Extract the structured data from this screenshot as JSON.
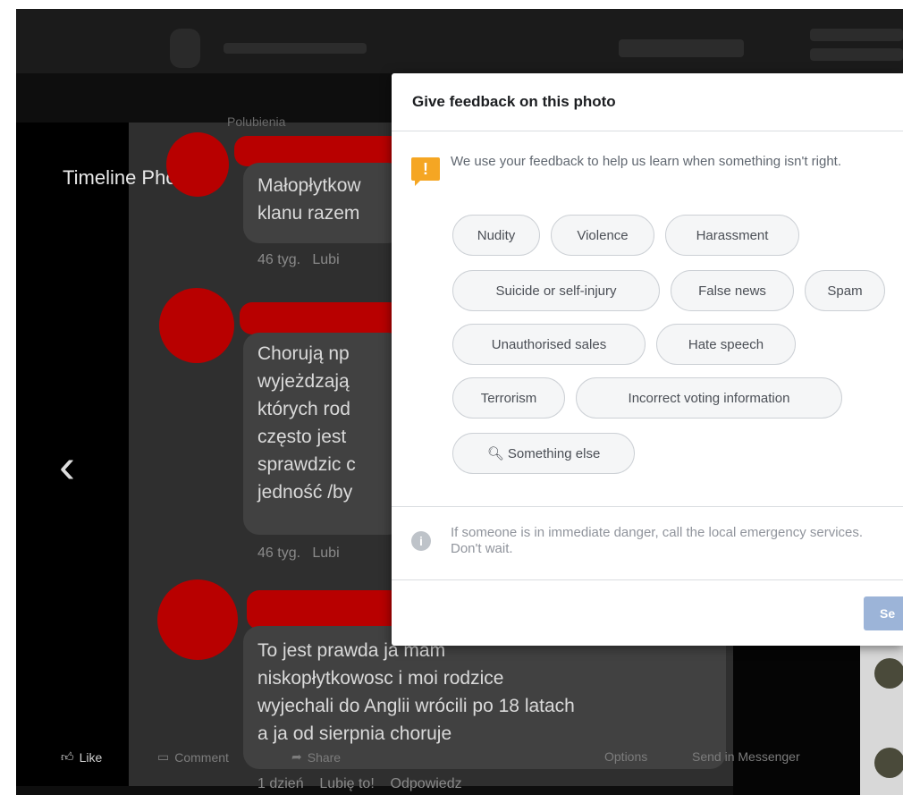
{
  "viewer": {
    "album_title": "Timeline Photos",
    "partial_label": "Polubienia",
    "prev_icon": "chevron-left-icon"
  },
  "comments": [
    {
      "lines": [
        "Małopłytkow",
        "klanu razem"
      ],
      "time": "46 tyg.",
      "like": "Lubi"
    },
    {
      "lines": [
        "Chorują np",
        "wyjeżdzają",
        "których rod",
        "często jest",
        "sprawdzic c",
        "jedność /by"
      ],
      "time": "46 tyg.",
      "like": "Lubi"
    },
    {
      "lines": [
        "To jest prawda ja mam",
        "niskopłytkowosc i moi rodzice",
        "wyjechali do Anglii wrócili po 18 latach",
        "a ja od sierpnia choruje"
      ],
      "time": "1 dzień",
      "like": "Lubię to!",
      "reply": "Odpowiedz"
    }
  ],
  "action_bar": {
    "like": "Like",
    "comment": "Comment",
    "share": "Share",
    "options": "Options",
    "send_messenger": "Send in Messenger"
  },
  "dialog": {
    "title": "Give feedback on this photo",
    "intro": "We use your feedback to help us learn when something isn't right.",
    "categories": [
      "Nudity",
      "Violence",
      "Harassment",
      "Suicide or self-injury",
      "False news",
      "Spam",
      "Unauthorised sales",
      "Hate speech",
      "Terrorism",
      "Incorrect voting information",
      "Something else"
    ],
    "emergency_note": "If someone is in immediate danger, call the local emergency services. Don't wait.",
    "send_label": "Se",
    "colors": {
      "warning": "#f5a623",
      "send_button": "#9cb4d8"
    }
  }
}
